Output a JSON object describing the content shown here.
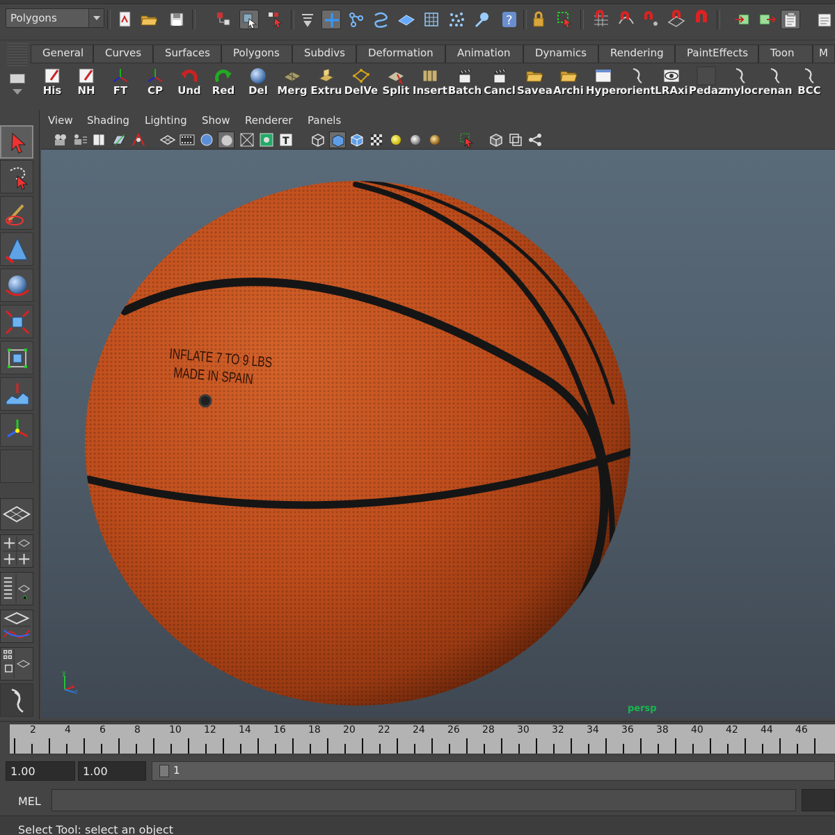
{
  "status_line": {
    "menu_set": "Polygons"
  },
  "shelf": {
    "tabs": [
      "General",
      "Curves",
      "Surfaces",
      "Polygons",
      "Subdivs",
      "Deformation",
      "Animation",
      "Dynamics",
      "Rendering",
      "PaintEffects",
      "Toon",
      "M"
    ],
    "buttons": [
      "His",
      "NH",
      "FT",
      "CP",
      "Und",
      "Red",
      "Del",
      "Merg",
      "Extru",
      "DelVe",
      "Split",
      "Insert",
      "Batch",
      "Cancl",
      "Savea",
      "Archi",
      "Hyper",
      "orient",
      "LRAxi",
      "Pedaz",
      "myloc",
      "renan",
      "BCC"
    ]
  },
  "panel": {
    "menus": [
      "View",
      "Shading",
      "Lighting",
      "Show",
      "Renderer",
      "Panels"
    ],
    "camera_label": "persp",
    "axis_labels": {
      "y": "y",
      "x": "x",
      "z": "z"
    },
    "ball_text": {
      "line1": "INFLATE 7 TO 9 LBS",
      "line2": "MADE IN SPAIN"
    },
    "colors": {
      "ball": "#c0521e",
      "seam": "#151515",
      "viewport_top": "#596a79",
      "viewport_bottom": "#3f4852",
      "camera_label": "#18b84e"
    }
  },
  "time_slider": {
    "labels": [
      "2",
      "4",
      "6",
      "8",
      "10",
      "12",
      "14",
      "16",
      "18",
      "20",
      "22",
      "24",
      "26",
      "28",
      "30",
      "32",
      "34",
      "36",
      "38",
      "40",
      "42",
      "44",
      "46"
    ]
  },
  "range_slider": {
    "start_time": "1.00",
    "playback_start": "1.00",
    "range_label": "1"
  },
  "command_line": {
    "label": "MEL",
    "input": ""
  },
  "help_line": {
    "text": "Select Tool: select an object"
  }
}
